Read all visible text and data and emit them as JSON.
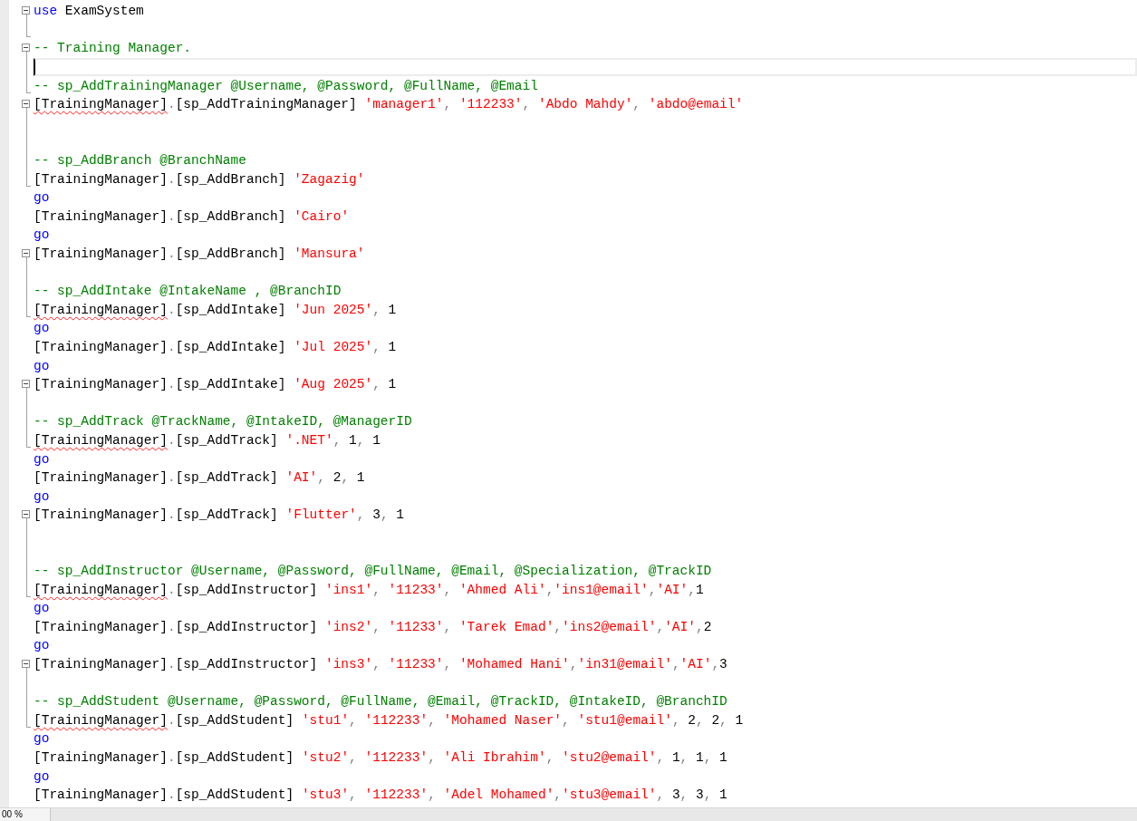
{
  "editor": {
    "lines": [
      {
        "kind": "fold-start",
        "current": false,
        "tokens": [
          {
            "kind": "keyword",
            "text": "use"
          },
          {
            "kind": "ident",
            "text": " ExamSystem"
          }
        ]
      },
      {
        "kind": "fold-end",
        "current": false
      },
      {
        "kind": "fold-start",
        "current": false,
        "tokens": [
          {
            "kind": "comment",
            "text": "-- Training Manager."
          }
        ]
      },
      {
        "kind": "fold-mid",
        "current": true
      },
      {
        "kind": "fold-end",
        "current": false,
        "tokens": [
          {
            "kind": "comment",
            "text": "-- sp_AddTrainingManager @Username, @Password, @FullName, @Email"
          }
        ]
      },
      {
        "kind": "fold-start",
        "current": false,
        "tokens": [
          {
            "kind": "error",
            "text": "[TrainingManager]"
          },
          {
            "kind": "op",
            "text": "."
          },
          {
            "kind": "ident",
            "text": "[sp_AddTrainingManager] "
          },
          {
            "kind": "string",
            "text": "'manager1'"
          },
          {
            "kind": "op",
            "text": ", "
          },
          {
            "kind": "string",
            "text": "'112233'"
          },
          {
            "kind": "op",
            "text": ", "
          },
          {
            "kind": "string",
            "text": "'Abdo Mahdy'"
          },
          {
            "kind": "op",
            "text": ", "
          },
          {
            "kind": "string",
            "text": "'abdo@email'"
          }
        ]
      },
      {
        "kind": "fold-mid",
        "current": false
      },
      {
        "kind": "fold-mid",
        "current": false
      },
      {
        "kind": "fold-mid",
        "current": false,
        "tokens": [
          {
            "kind": "comment",
            "text": "-- sp_AddBranch @BranchName"
          }
        ]
      },
      {
        "kind": "fold-end",
        "current": false,
        "tokens": [
          {
            "kind": "ident",
            "text": "[TrainingManager]"
          },
          {
            "kind": "op",
            "text": "."
          },
          {
            "kind": "ident",
            "text": "[sp_AddBranch] "
          },
          {
            "kind": "string",
            "text": "'Zagazig'"
          }
        ]
      },
      {
        "kind": "plain",
        "current": false,
        "tokens": [
          {
            "kind": "keyword",
            "text": "go"
          }
        ]
      },
      {
        "kind": "plain",
        "current": false,
        "tokens": [
          {
            "kind": "ident",
            "text": "[TrainingManager]"
          },
          {
            "kind": "op",
            "text": "."
          },
          {
            "kind": "ident",
            "text": "[sp_AddBranch] "
          },
          {
            "kind": "string",
            "text": "'Cairo'"
          }
        ]
      },
      {
        "kind": "plain",
        "current": false,
        "tokens": [
          {
            "kind": "keyword",
            "text": "go"
          }
        ]
      },
      {
        "kind": "fold-start",
        "current": false,
        "tokens": [
          {
            "kind": "ident",
            "text": "[TrainingManager]"
          },
          {
            "kind": "op",
            "text": "."
          },
          {
            "kind": "ident",
            "text": "[sp_AddBranch] "
          },
          {
            "kind": "string",
            "text": "'Mansura'"
          }
        ]
      },
      {
        "kind": "fold-mid",
        "current": false
      },
      {
        "kind": "fold-mid",
        "current": false,
        "tokens": [
          {
            "kind": "comment",
            "text": "-- sp_AddIntake @IntakeName , @BranchID"
          }
        ]
      },
      {
        "kind": "fold-end",
        "current": false,
        "tokens": [
          {
            "kind": "error",
            "text": "[TrainingManager]"
          },
          {
            "kind": "op",
            "text": "."
          },
          {
            "kind": "ident",
            "text": "[sp_AddIntake] "
          },
          {
            "kind": "string",
            "text": "'Jun 2025'"
          },
          {
            "kind": "op",
            "text": ", "
          },
          {
            "kind": "ident",
            "text": "1"
          }
        ]
      },
      {
        "kind": "plain",
        "current": false,
        "tokens": [
          {
            "kind": "keyword",
            "text": "go"
          }
        ]
      },
      {
        "kind": "plain",
        "current": false,
        "tokens": [
          {
            "kind": "ident",
            "text": "[TrainingManager]"
          },
          {
            "kind": "op",
            "text": "."
          },
          {
            "kind": "ident",
            "text": "[sp_AddIntake] "
          },
          {
            "kind": "string",
            "text": "'Jul 2025'"
          },
          {
            "kind": "op",
            "text": ", "
          },
          {
            "kind": "ident",
            "text": "1"
          }
        ]
      },
      {
        "kind": "plain",
        "current": false,
        "tokens": [
          {
            "kind": "keyword",
            "text": "go"
          }
        ]
      },
      {
        "kind": "fold-start",
        "current": false,
        "tokens": [
          {
            "kind": "ident",
            "text": "[TrainingManager]"
          },
          {
            "kind": "op",
            "text": "."
          },
          {
            "kind": "ident",
            "text": "[sp_AddIntake] "
          },
          {
            "kind": "string",
            "text": "'Aug 2025'"
          },
          {
            "kind": "op",
            "text": ", "
          },
          {
            "kind": "ident",
            "text": "1"
          }
        ]
      },
      {
        "kind": "fold-mid",
        "current": false
      },
      {
        "kind": "fold-mid",
        "current": false,
        "tokens": [
          {
            "kind": "comment",
            "text": "-- sp_AddTrack @TrackName, @IntakeID, @ManagerID"
          }
        ]
      },
      {
        "kind": "fold-end",
        "current": false,
        "tokens": [
          {
            "kind": "error",
            "text": "[TrainingManager]"
          },
          {
            "kind": "op",
            "text": "."
          },
          {
            "kind": "ident",
            "text": "[sp_AddTrack] "
          },
          {
            "kind": "string",
            "text": "'.NET'"
          },
          {
            "kind": "op",
            "text": ", "
          },
          {
            "kind": "ident",
            "text": "1"
          },
          {
            "kind": "op",
            "text": ", "
          },
          {
            "kind": "ident",
            "text": "1"
          }
        ]
      },
      {
        "kind": "plain",
        "current": false,
        "tokens": [
          {
            "kind": "keyword",
            "text": "go"
          }
        ]
      },
      {
        "kind": "plain",
        "current": false,
        "tokens": [
          {
            "kind": "ident",
            "text": "[TrainingManager]"
          },
          {
            "kind": "op",
            "text": "."
          },
          {
            "kind": "ident",
            "text": "[sp_AddTrack] "
          },
          {
            "kind": "string",
            "text": "'AI'"
          },
          {
            "kind": "op",
            "text": ", "
          },
          {
            "kind": "ident",
            "text": "2"
          },
          {
            "kind": "op",
            "text": ", "
          },
          {
            "kind": "ident",
            "text": "1"
          }
        ]
      },
      {
        "kind": "plain",
        "current": false,
        "tokens": [
          {
            "kind": "keyword",
            "text": "go"
          }
        ]
      },
      {
        "kind": "fold-start",
        "current": false,
        "tokens": [
          {
            "kind": "ident",
            "text": "[TrainingManager]"
          },
          {
            "kind": "op",
            "text": "."
          },
          {
            "kind": "ident",
            "text": "[sp_AddTrack] "
          },
          {
            "kind": "string",
            "text": "'Flutter'"
          },
          {
            "kind": "op",
            "text": ", "
          },
          {
            "kind": "ident",
            "text": "3"
          },
          {
            "kind": "op",
            "text": ", "
          },
          {
            "kind": "ident",
            "text": "1"
          }
        ]
      },
      {
        "kind": "fold-mid",
        "current": false
      },
      {
        "kind": "fold-mid",
        "current": false
      },
      {
        "kind": "fold-mid",
        "current": false,
        "tokens": [
          {
            "kind": "comment",
            "text": "-- sp_AddInstructor @Username, @Password, @FullName, @Email, @Specialization, @TrackID"
          }
        ]
      },
      {
        "kind": "fold-end",
        "current": false,
        "tokens": [
          {
            "kind": "error",
            "text": "[TrainingManager]"
          },
          {
            "kind": "op",
            "text": "."
          },
          {
            "kind": "ident",
            "text": "[sp_AddInstructor] "
          },
          {
            "kind": "string",
            "text": "'ins1'"
          },
          {
            "kind": "op",
            "text": ", "
          },
          {
            "kind": "string",
            "text": "'11233'"
          },
          {
            "kind": "op",
            "text": ", "
          },
          {
            "kind": "string",
            "text": "'Ahmed Ali'"
          },
          {
            "kind": "op",
            "text": ","
          },
          {
            "kind": "string",
            "text": "'ins1@email'"
          },
          {
            "kind": "op",
            "text": ","
          },
          {
            "kind": "string",
            "text": "'AI'"
          },
          {
            "kind": "op",
            "text": ","
          },
          {
            "kind": "ident",
            "text": "1"
          }
        ]
      },
      {
        "kind": "plain",
        "current": false,
        "tokens": [
          {
            "kind": "keyword",
            "text": "go"
          }
        ]
      },
      {
        "kind": "plain",
        "current": false,
        "tokens": [
          {
            "kind": "ident",
            "text": "[TrainingManager]"
          },
          {
            "kind": "op",
            "text": "."
          },
          {
            "kind": "ident",
            "text": "[sp_AddInstructor] "
          },
          {
            "kind": "string",
            "text": "'ins2'"
          },
          {
            "kind": "op",
            "text": ", "
          },
          {
            "kind": "string",
            "text": "'11233'"
          },
          {
            "kind": "op",
            "text": ", "
          },
          {
            "kind": "string",
            "text": "'Tarek Emad'"
          },
          {
            "kind": "op",
            "text": ","
          },
          {
            "kind": "string",
            "text": "'ins2@email'"
          },
          {
            "kind": "op",
            "text": ","
          },
          {
            "kind": "string",
            "text": "'AI'"
          },
          {
            "kind": "op",
            "text": ","
          },
          {
            "kind": "ident",
            "text": "2"
          }
        ]
      },
      {
        "kind": "plain",
        "current": false,
        "tokens": [
          {
            "kind": "keyword",
            "text": "go"
          }
        ]
      },
      {
        "kind": "fold-start",
        "current": false,
        "tokens": [
          {
            "kind": "ident",
            "text": "[TrainingManager]"
          },
          {
            "kind": "op",
            "text": "."
          },
          {
            "kind": "ident",
            "text": "[sp_AddInstructor] "
          },
          {
            "kind": "string",
            "text": "'ins3'"
          },
          {
            "kind": "op",
            "text": ", "
          },
          {
            "kind": "string",
            "text": "'11233'"
          },
          {
            "kind": "op",
            "text": ", "
          },
          {
            "kind": "string",
            "text": "'Mohamed Hani'"
          },
          {
            "kind": "op",
            "text": ","
          },
          {
            "kind": "string",
            "text": "'in31@email'"
          },
          {
            "kind": "op",
            "text": ","
          },
          {
            "kind": "string",
            "text": "'AI'"
          },
          {
            "kind": "op",
            "text": ","
          },
          {
            "kind": "ident",
            "text": "3"
          }
        ]
      },
      {
        "kind": "fold-mid",
        "current": false
      },
      {
        "kind": "fold-mid",
        "current": false,
        "tokens": [
          {
            "kind": "comment",
            "text": "-- sp_AddStudent @Username, @Password, @FullName, @Email, @TrackID, @IntakeID, @BranchID"
          }
        ]
      },
      {
        "kind": "fold-end",
        "current": false,
        "tokens": [
          {
            "kind": "error",
            "text": "[TrainingManager]"
          },
          {
            "kind": "op",
            "text": "."
          },
          {
            "kind": "ident",
            "text": "[sp_AddStudent] "
          },
          {
            "kind": "string",
            "text": "'stu1'"
          },
          {
            "kind": "op",
            "text": ", "
          },
          {
            "kind": "string",
            "text": "'112233'"
          },
          {
            "kind": "op",
            "text": ", "
          },
          {
            "kind": "string",
            "text": "'Mohamed Naser'"
          },
          {
            "kind": "op",
            "text": ", "
          },
          {
            "kind": "string",
            "text": "'stu1@email'"
          },
          {
            "kind": "op",
            "text": ", "
          },
          {
            "kind": "ident",
            "text": "2"
          },
          {
            "kind": "op",
            "text": ", "
          },
          {
            "kind": "ident",
            "text": "2"
          },
          {
            "kind": "op",
            "text": ", "
          },
          {
            "kind": "ident",
            "text": "1"
          }
        ]
      },
      {
        "kind": "plain",
        "current": false,
        "tokens": [
          {
            "kind": "keyword",
            "text": "go"
          }
        ]
      },
      {
        "kind": "plain",
        "current": false,
        "tokens": [
          {
            "kind": "ident",
            "text": "[TrainingManager]"
          },
          {
            "kind": "op",
            "text": "."
          },
          {
            "kind": "ident",
            "text": "[sp_AddStudent] "
          },
          {
            "kind": "string",
            "text": "'stu2'"
          },
          {
            "kind": "op",
            "text": ", "
          },
          {
            "kind": "string",
            "text": "'112233'"
          },
          {
            "kind": "op",
            "text": ", "
          },
          {
            "kind": "string",
            "text": "'Ali Ibrahim'"
          },
          {
            "kind": "op",
            "text": ", "
          },
          {
            "kind": "string",
            "text": "'stu2@email'"
          },
          {
            "kind": "op",
            "text": ", "
          },
          {
            "kind": "ident",
            "text": "1"
          },
          {
            "kind": "op",
            "text": ", "
          },
          {
            "kind": "ident",
            "text": "1"
          },
          {
            "kind": "op",
            "text": ", "
          },
          {
            "kind": "ident",
            "text": "1"
          }
        ]
      },
      {
        "kind": "plain",
        "current": false,
        "tokens": [
          {
            "kind": "keyword",
            "text": "go"
          }
        ]
      },
      {
        "kind": "plain",
        "current": false,
        "tokens": [
          {
            "kind": "ident",
            "text": "[TrainingManager]"
          },
          {
            "kind": "op",
            "text": "."
          },
          {
            "kind": "ident",
            "text": "[sp_AddStudent] "
          },
          {
            "kind": "string",
            "text": "'stu3'"
          },
          {
            "kind": "op",
            "text": ", "
          },
          {
            "kind": "string",
            "text": "'112233'"
          },
          {
            "kind": "op",
            "text": ", "
          },
          {
            "kind": "string",
            "text": "'Adel Mohamed'"
          },
          {
            "kind": "op",
            "text": ","
          },
          {
            "kind": "string",
            "text": "'stu3@email'"
          },
          {
            "kind": "op",
            "text": ", "
          },
          {
            "kind": "ident",
            "text": "3"
          },
          {
            "kind": "op",
            "text": ", "
          },
          {
            "kind": "ident",
            "text": "3"
          },
          {
            "kind": "op",
            "text": ", "
          },
          {
            "kind": "ident",
            "text": "1"
          }
        ]
      }
    ]
  },
  "status_bar": {
    "zoom": "00 %"
  }
}
